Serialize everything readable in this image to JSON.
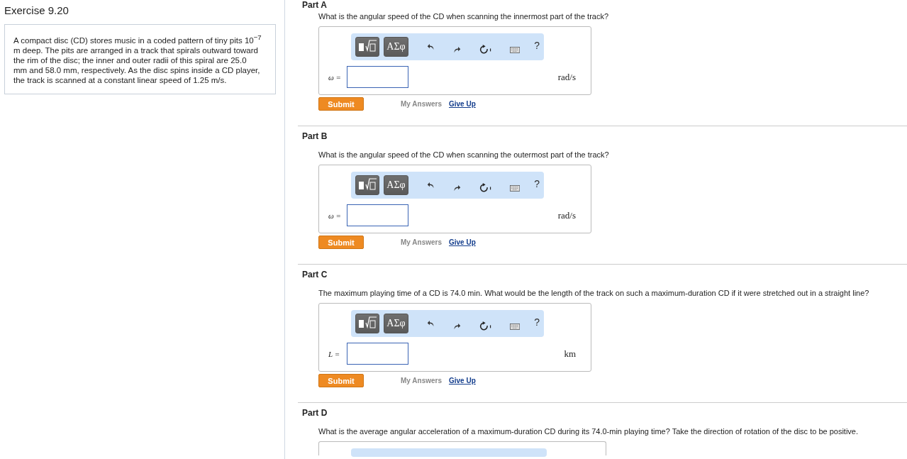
{
  "exercise": {
    "title": "Exercise 9.20",
    "text": "A compact disc (CD) stores music in a coded pattern of tiny pits 10$^{−7}$ m deep. The pits are arranged in a track that spirals outward toward the rim of the disc; the inner and outer radii of this spiral are 25.0 mm and 58.0 mm, respectively. As the disc spins inside a CD player, the track is scanned at a constant linear speed of 1.25 m/s."
  },
  "parts": [
    {
      "kind": "full",
      "heading": "Part A",
      "question": "What is the angular speed of the CD when scanning the innermost part of the track?",
      "toolbar": {
        "symbols": "ΑΣφ",
        "help": "?"
      },
      "variable": "ω =",
      "unit": "rad/s",
      "actions": {
        "submit": "Submit",
        "my_answers": "My Answers",
        "give_up": "Give Up"
      }
    },
    {
      "kind": "full",
      "heading": "Part B",
      "question": "What is the angular speed of the CD when scanning the outermost part of the track?",
      "toolbar": {
        "symbols": "ΑΣφ",
        "help": "?"
      },
      "variable": "ω =",
      "unit": "rad/s",
      "actions": {
        "submit": "Submit",
        "my_answers": "My Answers",
        "give_up": "Give Up"
      }
    },
    {
      "kind": "full",
      "heading": "Part C",
      "question": "The maximum playing time of a CD is 74.0 min. What would be the length of the track on such a maximum-duration CD if it were stretched out in a straight line?",
      "toolbar": {
        "symbols": "ΑΣφ",
        "help": "?"
      },
      "variable": "L =",
      "unit": "km",
      "actions": {
        "submit": "Submit",
        "my_answers": "My Answers",
        "give_up": "Give Up"
      }
    },
    {
      "kind": "cut",
      "heading": "Part D",
      "question": "What is the average angular acceleration of a maximum-duration CD during its 74.0-min playing time? Take the direction of rotation of the disc to be positive."
    }
  ]
}
